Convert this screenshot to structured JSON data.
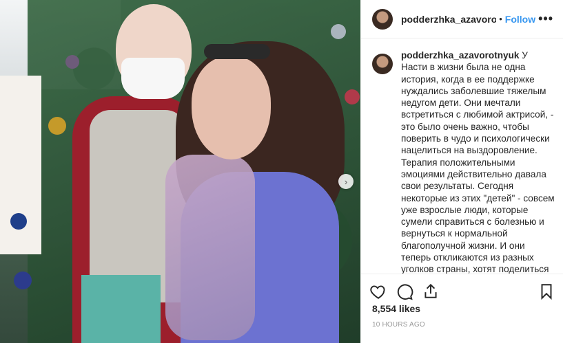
{
  "post": {
    "username": "podderzhka_azavorotnyuk",
    "header_username": "podderzhka_azavorotny",
    "separator": "•",
    "follow_label": "Follow",
    "more_label": "•••",
    "caption": "У Насти в жизни была не одна история, когда в ее поддержке нуждались заболевшие тяжелым недугом дети. Они мечтали встретиться с любимой актрисой, - это было очень важно, чтобы поверить в чудо и психологически нацелиться на выздоровление. Терапия положительными эмоциями действительно давала свои результаты. Сегодня некоторые из этих \"детей\" - совсем уже взрослые люди, которые сумели справиться с болезнью и вернуться к нормальной благополучной жизни. И они теперь откликаются из разных уголков страны, хотят поделиться своим теплом, как когда-то Настя делилась с ними",
    "likes": "8,554 likes",
    "time": "10 HOURS AGO",
    "carousel_next": "›"
  },
  "icons": {
    "like": "heart-icon",
    "comment": "comment-icon",
    "share": "share-icon",
    "save": "bookmark-icon"
  },
  "colors": {
    "follow": "#3897f0",
    "text": "#262626",
    "muted": "#999999"
  }
}
